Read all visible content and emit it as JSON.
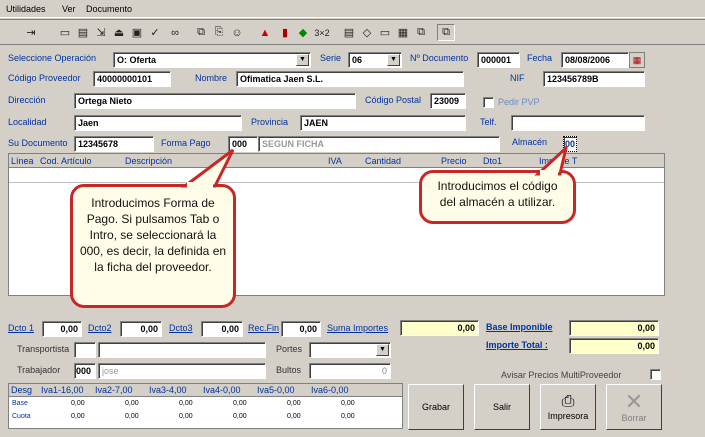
{
  "menu": {
    "items": [
      "Utilidades",
      "Ver",
      "Documento"
    ]
  },
  "toolbar": {
    "icons": [
      "exit-icon",
      "new-icon",
      "open-icon",
      "import-icon",
      "save-icon",
      "check-icon",
      "binoculars-icon",
      "copy-icon",
      "paste-icon",
      "mask-icon",
      "warning-icon",
      "book-icon",
      "gem-icon",
      "multiply-icon",
      "doc-icon",
      "eraser-icon",
      "print-icon",
      "calculator-icon",
      "copy2-icon"
    ],
    "multiply_label": "3×2"
  },
  "form": {
    "operacion_label": "Seleccione Operación",
    "operacion_value": "O: Oferta",
    "serie_label": "Serie",
    "serie_value": "06",
    "ndoc_label": "Nº Documento",
    "ndoc_value": "000001",
    "fecha_label": "Fecha",
    "fecha_value": "08/08/2006",
    "codprov_label": "Código Proveedor",
    "codprov_value": "40000000101",
    "nombre_label": "Nombre",
    "nombre_value": "Ofimatica Jaen S.L.",
    "nif_label": "NIF",
    "nif_value": "123456789B",
    "direccion_label": "Dirección",
    "direccion_value": "Ortega Nieto",
    "cp_label": "Código Postal",
    "cp_value": "23009",
    "pedir_pvp_label": "Pedir PVP",
    "localidad_label": "Localidad",
    "localidad_value": "Jaen",
    "provincia_label": "Provincia",
    "provincia_value": "JAEN",
    "telf_label": "Telf.",
    "telf_value": "",
    "sudoc_label": "Su Documento",
    "sudoc_value": "12345678",
    "formapago_label": "Forma Pago",
    "formapago_code": "000",
    "formapago_desc": "SEGUN FICHA",
    "almacen_label": "Almacén",
    "almacen_value": "00"
  },
  "grid": {
    "columns": [
      "Línea",
      "Cod. Artículo",
      "Descripción",
      "IVA",
      "Cantidad",
      "Precio",
      "Dto1",
      "Importe T"
    ]
  },
  "callouts": {
    "forma_pago": "Introducimos Forma de Pago. Si pulsamos Tab o Intro, se seleccionará la 000, es decir, la definida en la ficha del proveedor.",
    "almacen": "Introducimos el código del almacén a utilizar."
  },
  "totals": {
    "dcto1_label": "Dcto 1",
    "dcto1_value": "0,00",
    "dcto2_label": "Dcto2",
    "dcto2_value": "0,00",
    "dcto3_label": "Dcto3",
    "dcto3_value": "0,00",
    "recfin_label": "Rec.Fin",
    "recfin_value": "0,00",
    "suma_label": "Suma Importes",
    "suma_value": "0,00",
    "base_label": "Base Imponible",
    "base_value": "0,00",
    "importe_label": "Importe Total :",
    "importe_value": "0,00"
  },
  "bottom": {
    "transportista_label": "Transportista",
    "transportista_value": "",
    "portes_label": "Portes",
    "portes_value": "",
    "trabajador_label": "Trabajador",
    "trabajador_code": "000",
    "trabajador_name": "jose",
    "bultos_label": "Bultos",
    "bultos_value": "0",
    "avisar_label": "Avisar Precios MultiProveedor"
  },
  "iva_table": {
    "headers": [
      "Desg",
      "Iva1-16,00",
      "Iva2-7,00",
      "Iva3-4,00",
      "Iva4-0,00",
      "Iva5-0,00",
      "Iva6-0,00"
    ],
    "row_labels": [
      "Base",
      "Cuota"
    ],
    "cell_value": "0,00"
  },
  "buttons": {
    "grabar": "Grabar",
    "salir": "Salir",
    "impresora": "Impresora",
    "borrar": "Borrar"
  }
}
